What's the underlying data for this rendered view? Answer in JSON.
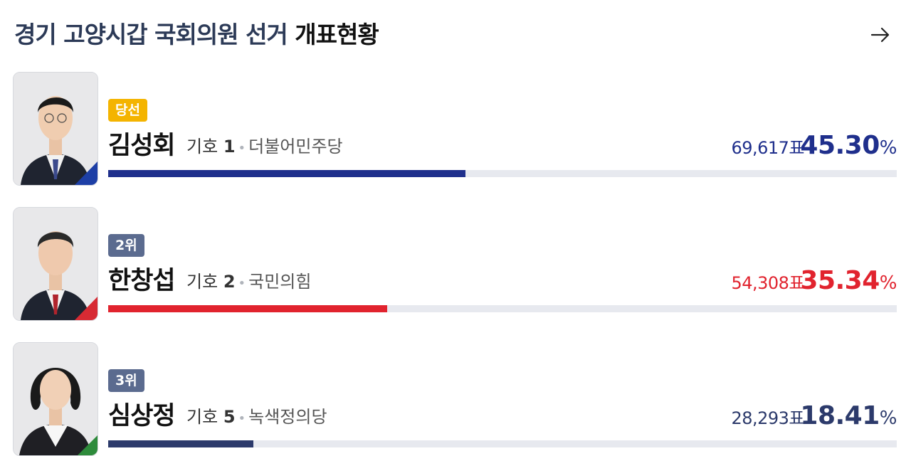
{
  "header": {
    "title_part1": "경기 고양시갑 국회의원 선거 ",
    "title_part2": "개표현황",
    "more_icon": "arrow-right-icon"
  },
  "colors": {
    "democratic": "#1f2f8c",
    "ppp": "#e1232e",
    "green_justice": "#2c3a6b",
    "winner_badge": "#f4b400",
    "rank_badge": "#5b6b8f"
  },
  "candidates": [
    {
      "badge": "당선",
      "name": "김성회",
      "number_label": "기호",
      "number": "1",
      "party": "더불어민주당",
      "votes": "69,617표",
      "percent": "45.30",
      "percent_unit": "%",
      "share": 45.3
    },
    {
      "badge": "2위",
      "name": "한창섭",
      "number_label": "기호",
      "number": "2",
      "party": "국민의힘",
      "votes": "54,308표",
      "percent": "35.34",
      "percent_unit": "%",
      "share": 35.34
    },
    {
      "badge": "3위",
      "name": "심상정",
      "number_label": "기호",
      "number": "5",
      "party": "녹색정의당",
      "votes": "28,293표",
      "percent": "18.41",
      "percent_unit": "%",
      "share": 18.41
    }
  ]
}
